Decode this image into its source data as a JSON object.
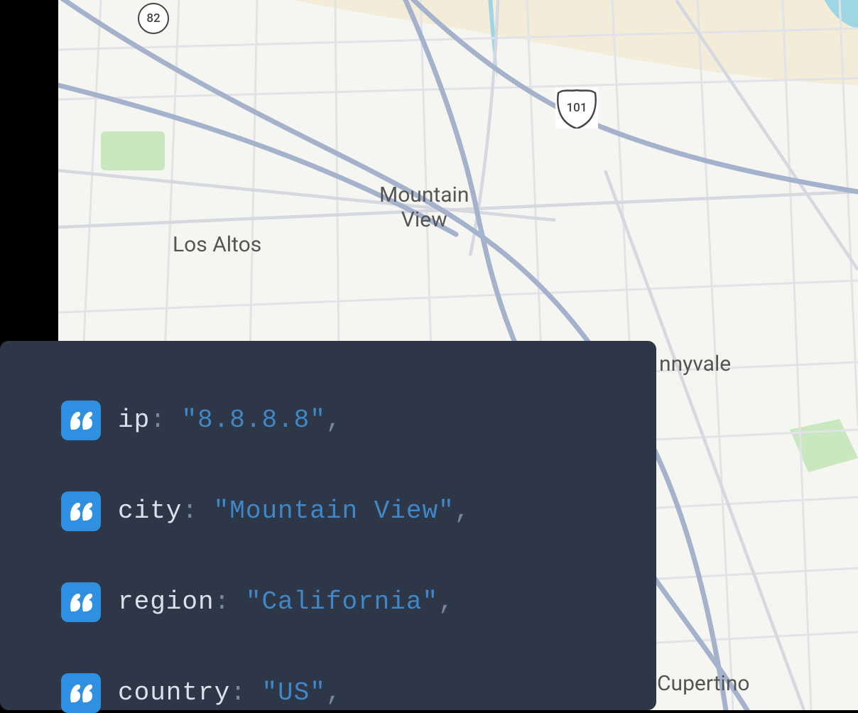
{
  "map": {
    "labels": {
      "mountain_view_l1": "Mountain",
      "mountain_view_l2": "View",
      "los_altos": "Los Altos",
      "sunnyvale": "nnyvale",
      "cupertino": "Cupertino"
    },
    "shields": {
      "state_82": "82",
      "us_101": "101"
    }
  },
  "code": {
    "rows": [
      {
        "key": "ip",
        "value": "\"8.8.8.8\""
      },
      {
        "key": "city",
        "value": "\"Mountain View\""
      },
      {
        "key": "region",
        "value": "\"California\""
      },
      {
        "key": "country",
        "value": "\"US\""
      }
    ],
    "colon": ":",
    "comma": ","
  }
}
